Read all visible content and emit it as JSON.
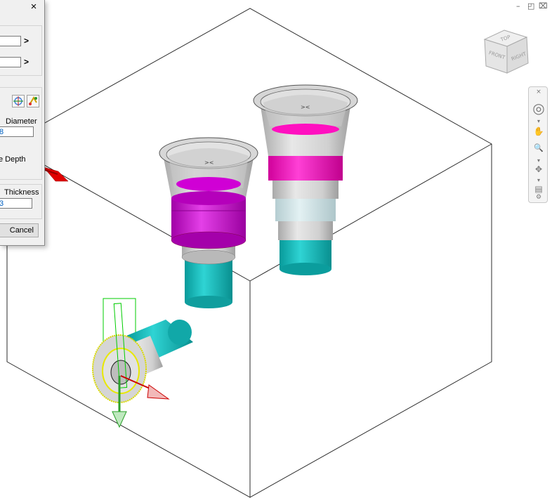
{
  "dialog": {
    "close_glyph": "×",
    "arrow_1": ">",
    "arrow_2": ">",
    "diameter_label": "Diameter",
    "diameter_value": "8",
    "depth_label": "e Depth",
    "thickness_label": "Thickness",
    "thickness_value": "3",
    "cancel_label": "Cancel"
  },
  "window_controls": {
    "minimize": "–",
    "restore": "◰",
    "close": "⌧"
  },
  "viewcube": {
    "top": "TOP",
    "front": "FRONT",
    "right": "RIGHT"
  },
  "navbar": {
    "items": [
      {
        "name": "close-icon",
        "glyph": "×"
      },
      {
        "name": "steering-wheel-icon",
        "glyph": "◎"
      },
      {
        "name": "dropdown-icon",
        "glyph": "▾"
      },
      {
        "name": "pan-icon",
        "glyph": "✋"
      },
      {
        "name": "zoom-icon",
        "glyph": "🔍"
      },
      {
        "name": "dropdown-icon",
        "glyph": "▾"
      },
      {
        "name": "orbit-icon",
        "glyph": "✥"
      },
      {
        "name": "dropdown-icon",
        "glyph": "▾"
      },
      {
        "name": "look-at-icon",
        "glyph": "▤"
      },
      {
        "name": "settings-icon",
        "glyph": "⚙"
      }
    ]
  },
  "colors": {
    "magenta": "#d100d1",
    "pink": "#ff22cc",
    "cyan": "#1fc4c4",
    "light_cyan": "#cfe7ea",
    "metal": "#c9c9c9",
    "highlight": "#e4e400",
    "axis_red": "#e00000",
    "axis_green": "#2aa02a"
  }
}
